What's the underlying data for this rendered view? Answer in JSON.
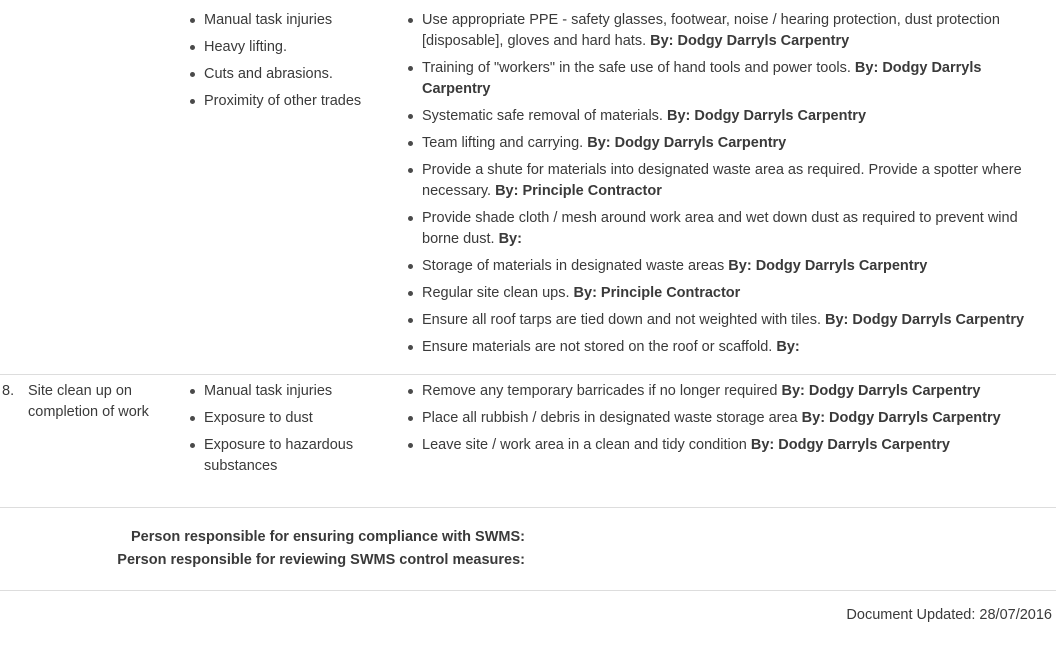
{
  "rows": [
    {
      "num": "",
      "task": "",
      "hazards": [
        "Manual task injuries",
        "Heavy lifting.",
        "Cuts and abrasions.",
        "Proximity of other trades"
      ],
      "controls": [
        {
          "text": "Use appropriate PPE - safety glasses, footwear, noise / hearing protection, dust protection [disposable], gloves and hard hats. ",
          "by": "By: Dodgy Darryls Carpentry"
        },
        {
          "text": "Training of \"workers\" in the safe use of hand tools and power tools.   ",
          "by": "By: Dodgy Darryls Carpentry"
        },
        {
          "text": "Systematic safe removal of materials.  ",
          "by": "By: Dodgy Darryls Carpentry"
        },
        {
          "text": "Team lifting and carrying.  ",
          "by": "By: Dodgy Darryls Carpentry"
        },
        {
          "text": "Provide a shute for materials into designated waste area as required. Provide a spotter where necessary. ",
          "by": "By: Principle Contractor"
        },
        {
          "text": "Provide shade cloth / mesh around work area and wet down dust as required to prevent wind borne dust. ",
          "by": "By:"
        },
        {
          "text": "Storage of materials in designated waste areas   ",
          "by": "By: Dodgy Darryls Carpentry"
        },
        {
          "text": "Regular site clean ups. ",
          "by": "By: Principle Contractor"
        },
        {
          "text": "Ensure all roof tarps are tied down and not weighted with tiles.   ",
          "by": "By: Dodgy Darryls Carpentry"
        },
        {
          "text": "Ensure materials are not stored on the roof or scaffold.   ",
          "by": "By:"
        }
      ]
    },
    {
      "num": "8.",
      "task": "Site clean up on completion of work",
      "hazards": [
        "Manual task injuries",
        "Exposure to dust",
        "Exposure to hazardous substances"
      ],
      "controls": [
        {
          "text": "Remove any temporary barricades if no longer required   ",
          "by": "By: Dodgy Darryls Carpentry"
        },
        {
          "text": "Place all rubbish / debris in designated waste storage area   ",
          "by": "By: Dodgy Darryls Carpentry"
        },
        {
          "text": "Leave site / work area in a clean and tidy condition   ",
          "by": "By: Dodgy Darryls Carpentry"
        }
      ]
    }
  ],
  "compliance": {
    "line1_label": "Person responsible for ensuring compliance with SWMS:",
    "line2_label": "Person responsible for reviewing SWMS control measures:"
  },
  "document_updated": "Document Updated: 28/07/2016"
}
